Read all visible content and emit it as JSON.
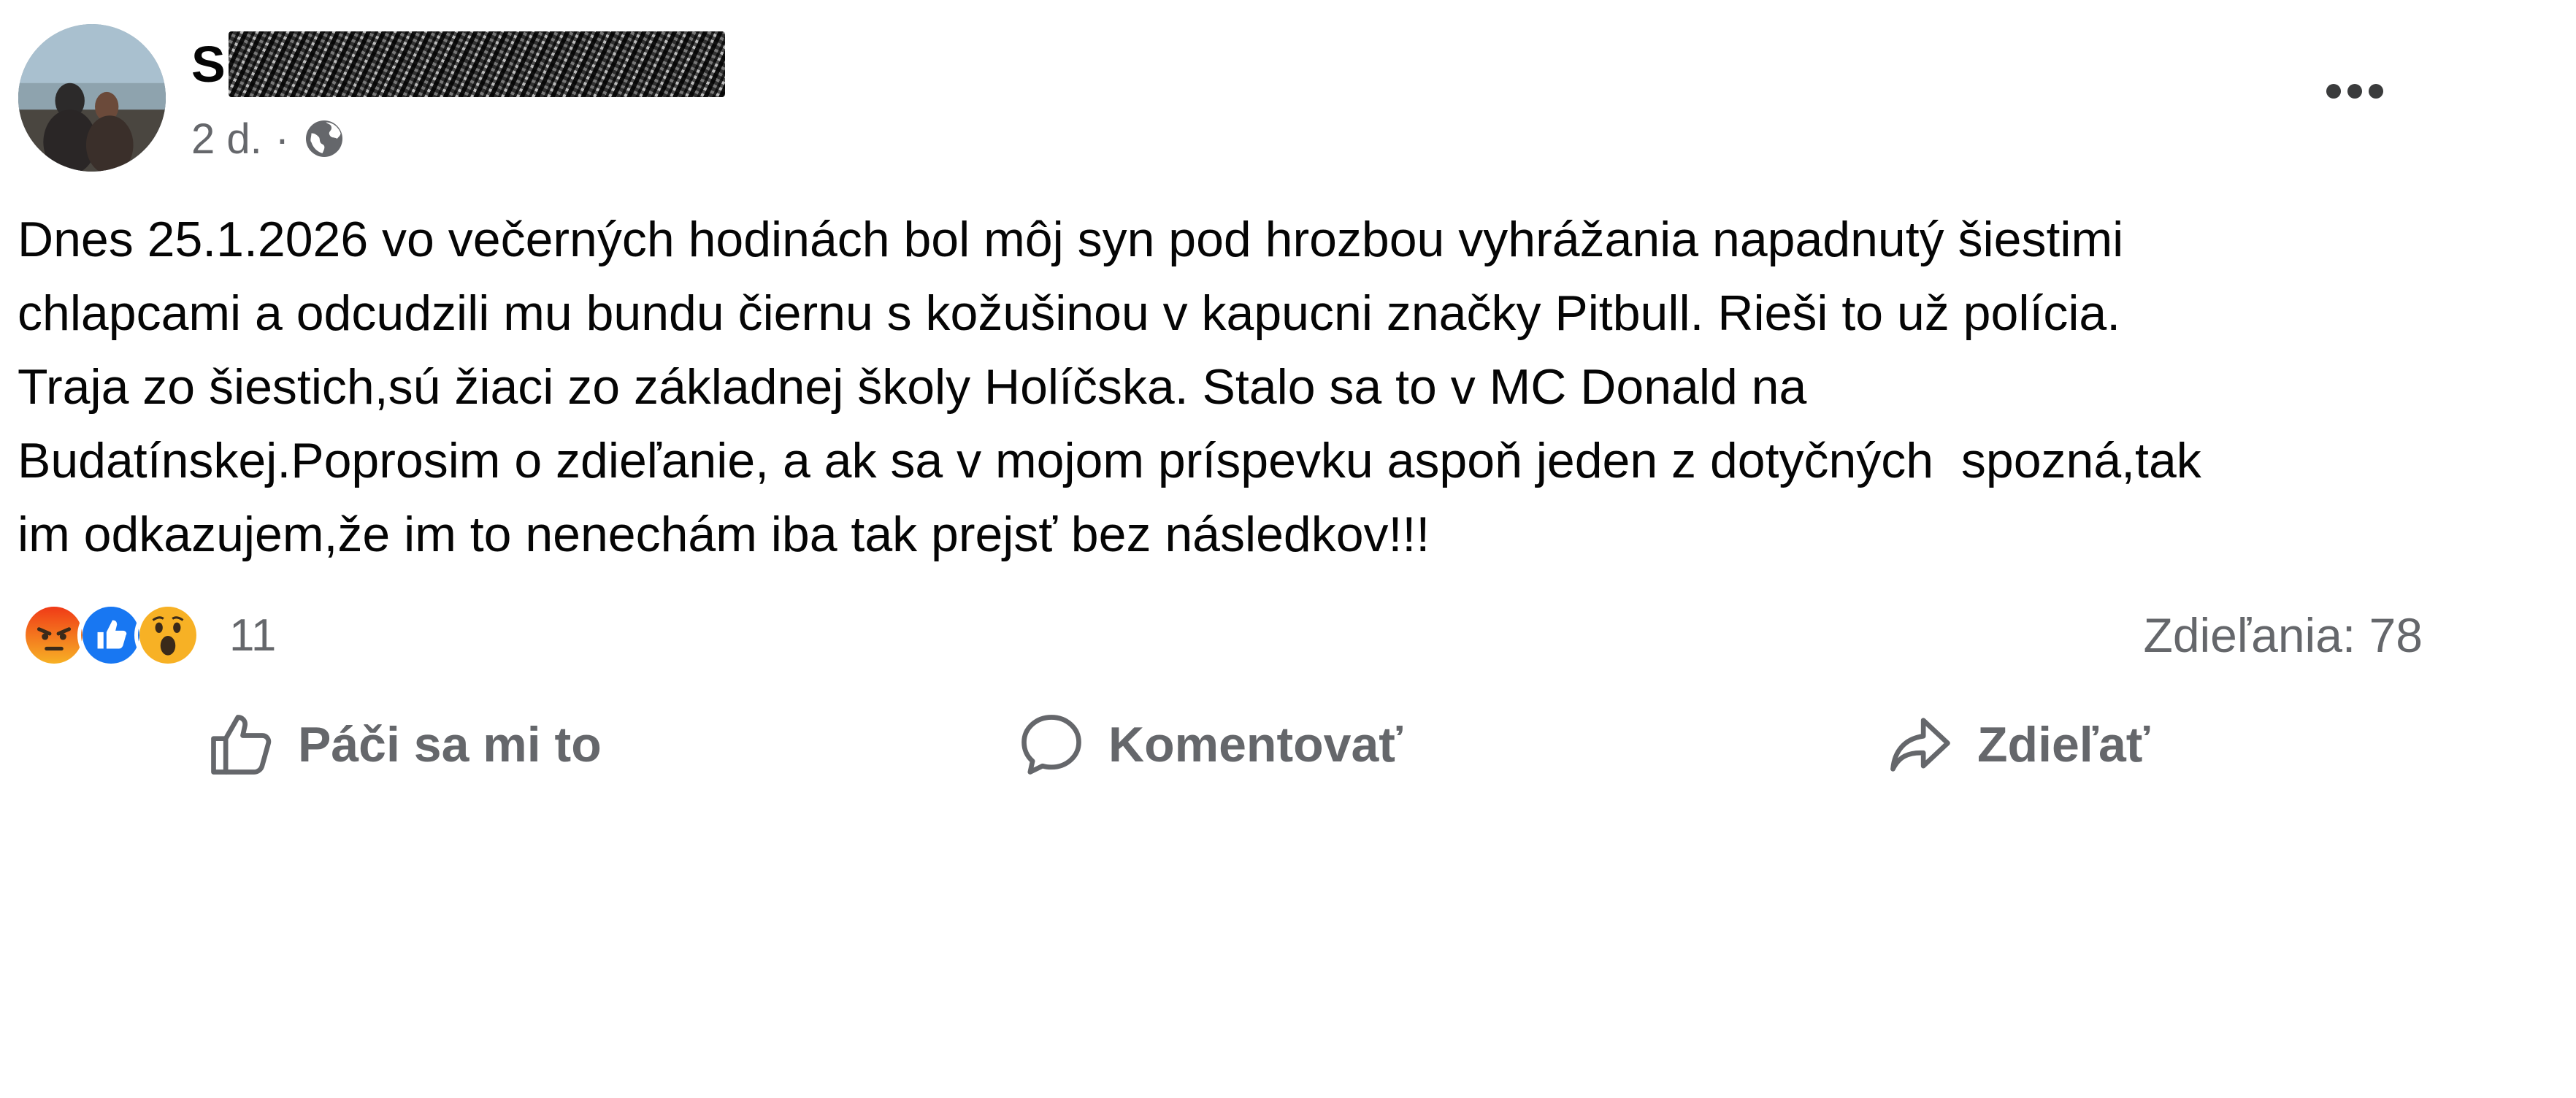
{
  "post": {
    "author": {
      "name_visible": "S",
      "name_redacted": true
    },
    "timestamp": "2 d.",
    "separator": "·",
    "audience_icon": "globe-icon",
    "menu_icon": "more-options-icon",
    "text": "Dnes 25.1.2026 vo večerných hodinách bol môj syn pod hrozbou vyhrážania napadnutý šiestimi\nchlapcami a odcudzili mu bundu čiernu s kožušinou v kapucni značky Pitbull. Rieši to už polícia.\nTraja zo šiestich,sú žiaci zo základnej školy Holíčska. Stalo sa to v MC Donald na\nBudatínskej.Poprosim o zdieľanie, a ak sa v mojom príspevku aspoň jeden z dotyčných  spozná,tak\nim odkazujem,že im to nenechám iba tak prejsť bez následkov!!!"
  },
  "reactions": {
    "types": [
      "angry",
      "like",
      "wow"
    ],
    "count": "11",
    "shares_label": "Zdieľania: 78"
  },
  "actions": {
    "like": {
      "label": "Páči sa mi to",
      "icon": "thumbs-up-icon"
    },
    "comment": {
      "label": "Komentovať",
      "icon": "comment-icon"
    },
    "share": {
      "label": "Zdieľať",
      "icon": "share-arrow-icon"
    }
  },
  "colors": {
    "text": "#050505",
    "secondary_text": "#65676b",
    "like_blue": "#1877f2",
    "angry_red": "#e9710f",
    "wow_yellow": "#f7b125"
  }
}
